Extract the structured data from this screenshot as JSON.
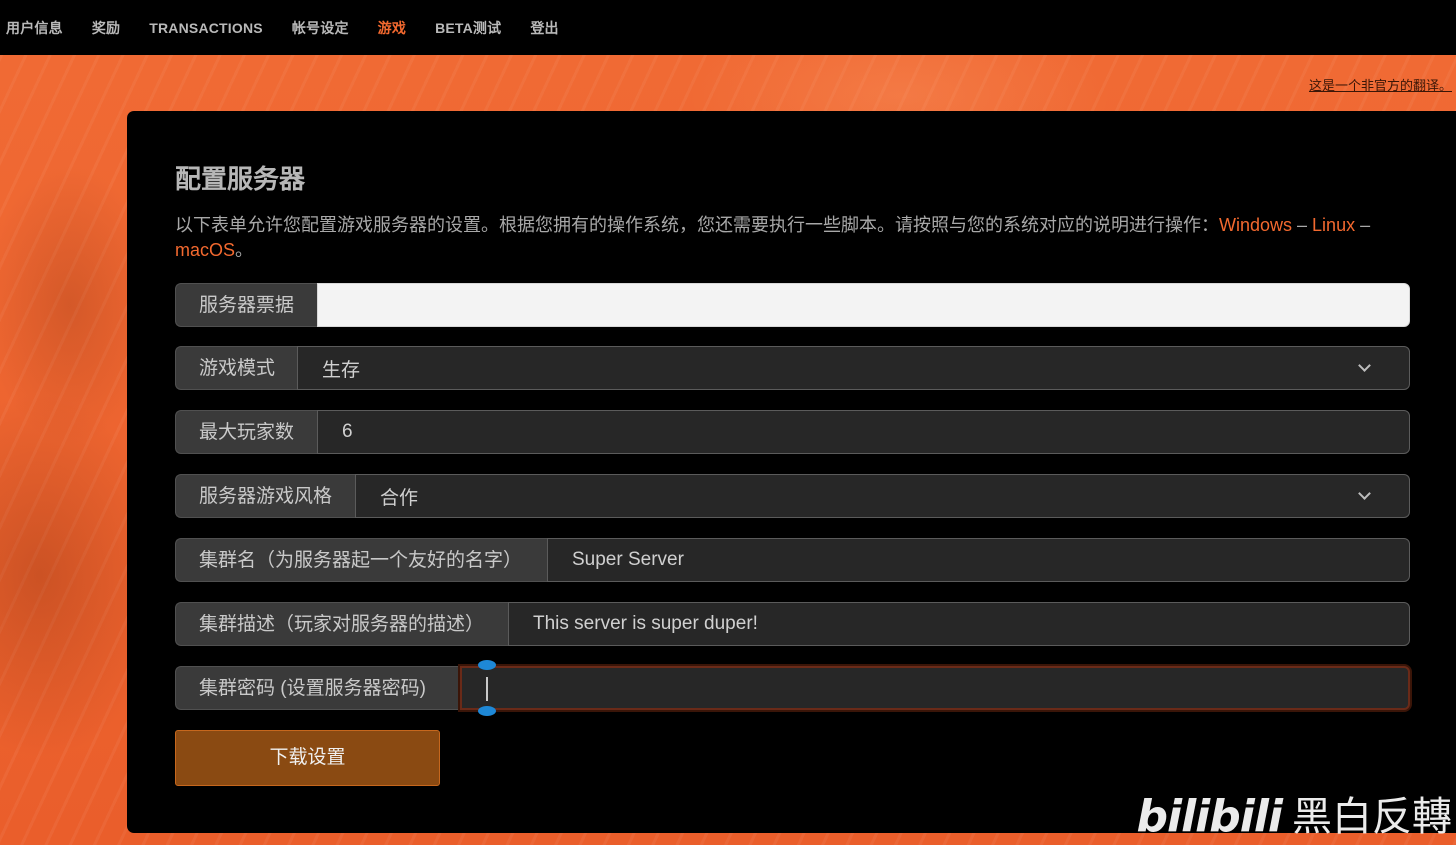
{
  "nav": {
    "items": [
      {
        "label": "用户信息",
        "active": false
      },
      {
        "label": "奖励",
        "active": false
      },
      {
        "label": "TRANSACTIONS",
        "active": false
      },
      {
        "label": "帐号设定",
        "active": false
      },
      {
        "label": "游戏",
        "active": true
      },
      {
        "label": "BETA测试",
        "active": false
      },
      {
        "label": "登出",
        "active": false
      }
    ]
  },
  "translation_note": "这是一个非官方的翻译。",
  "panel": {
    "title": "配置服务器",
    "description": "以下表单允许您配置游戏服务器的设置。根据您拥有的操作系统，您还需要执行一些脚本。请按照与您的系统对应的说明进行操作：",
    "os_links": {
      "windows": "Windows",
      "sep1": " – ",
      "linux": "Linux",
      "sep2": " – ",
      "macos": "macOS",
      "end": "。"
    }
  },
  "form": {
    "server_token": {
      "label": "服务器票据",
      "value": ""
    },
    "game_mode": {
      "label": "游戏模式",
      "value": "生存"
    },
    "max_players": {
      "label": "最大玩家数",
      "value": "6"
    },
    "game_style": {
      "label": "服务器游戏风格",
      "value": "合作"
    },
    "cluster_name": {
      "label": "集群名（为服务器起一个友好的名字）",
      "value": "Super Server"
    },
    "cluster_description": {
      "label": "集群描述（玩家对服务器的描述）",
      "value": "This server is super duper!"
    },
    "cluster_password": {
      "label": "集群密码 (设置服务器密码)",
      "value": ""
    }
  },
  "download_button": "下载设置",
  "watermark": {
    "logo": "bilibili",
    "text": "黑白反轉"
  },
  "colors": {
    "accent": "#f3692f",
    "background": "#ee6a36",
    "panel": "#000000",
    "button": "#8a4a12"
  }
}
